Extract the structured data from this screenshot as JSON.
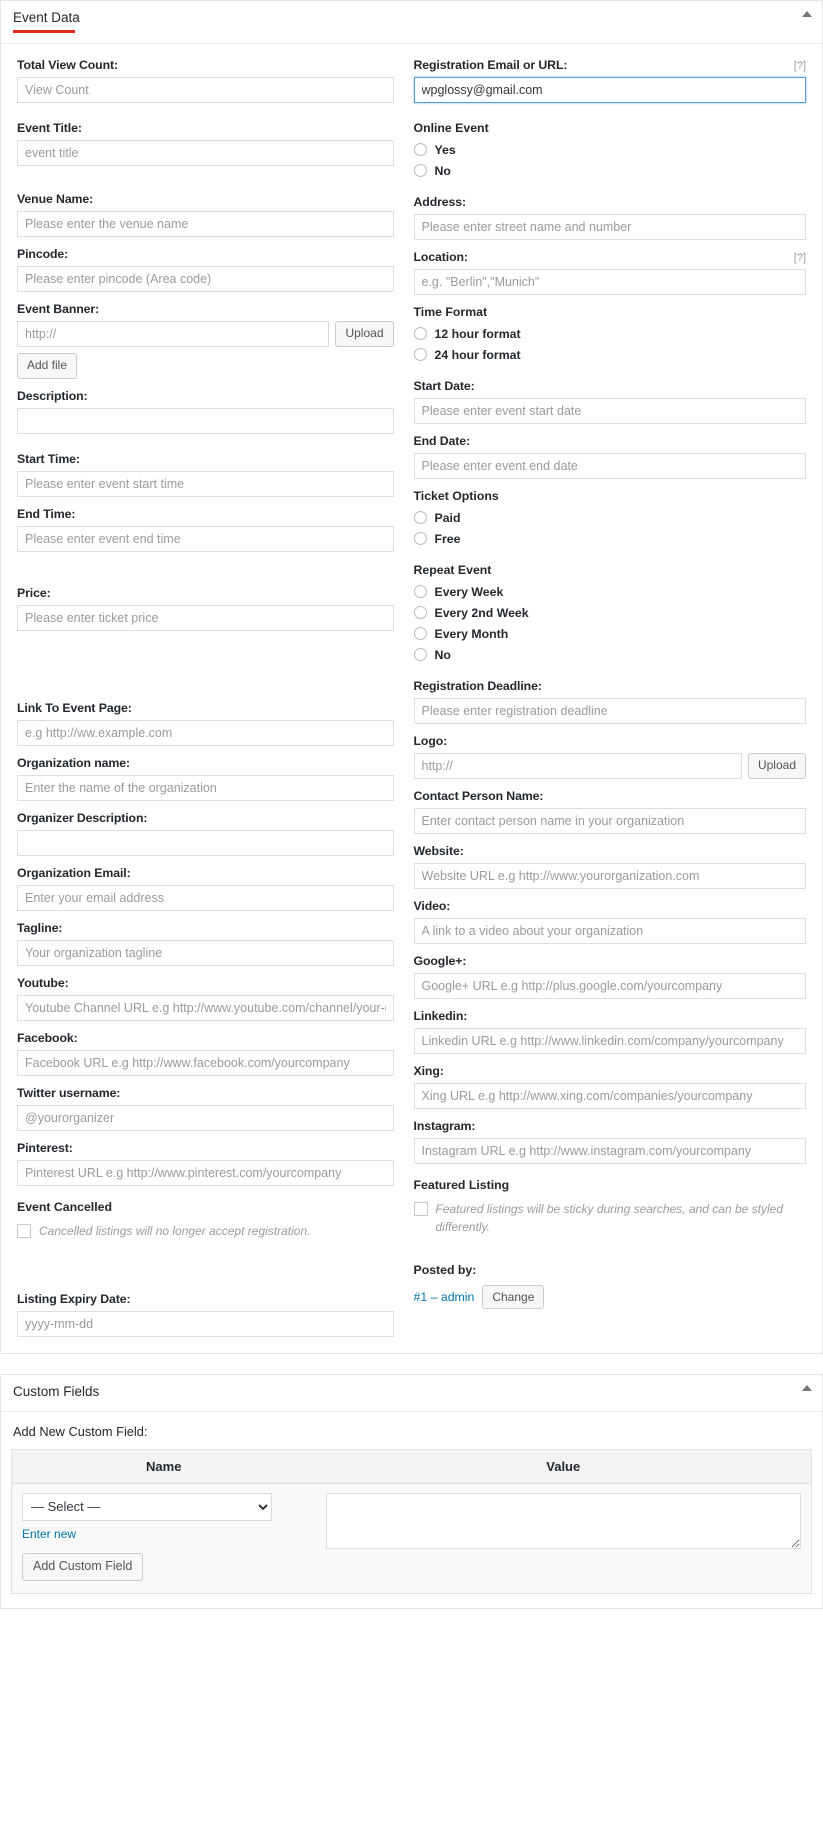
{
  "event_data_box": {
    "title": "Event Data",
    "collapse_icon": "chevron-up-icon",
    "help_tip": "[?]",
    "left": {
      "total_view_count": {
        "label": "Total View Count:",
        "placeholder": "View Count",
        "value": ""
      },
      "event_title": {
        "label": "Event Title:",
        "placeholder": "event title",
        "value": ""
      },
      "venue_name": {
        "label": "Venue Name:",
        "placeholder": "Please enter the venue name",
        "value": ""
      },
      "pincode": {
        "label": "Pincode:",
        "placeholder": "Please enter pincode (Area code)",
        "value": ""
      },
      "event_banner": {
        "label": "Event Banner:",
        "placeholder": "http://",
        "value": "",
        "upload_label": "Upload",
        "add_file_label": "Add file"
      },
      "description": {
        "label": "Description:",
        "value": ""
      },
      "start_time": {
        "label": "Start Time:",
        "placeholder": "Please enter event start time",
        "value": ""
      },
      "end_time": {
        "label": "End Time:",
        "placeholder": "Please enter event end time",
        "value": ""
      },
      "price": {
        "label": "Price:",
        "placeholder": "Please enter ticket price",
        "value": ""
      },
      "link_to_event_page": {
        "label": "Link To Event Page:",
        "placeholder": "e.g http://ww.example.com",
        "value": ""
      },
      "organization_name": {
        "label": "Organization name:",
        "placeholder": "Enter the name of the organization",
        "value": ""
      },
      "organizer_description": {
        "label": "Organizer Description:",
        "value": ""
      },
      "organization_email": {
        "label": "Organization Email:",
        "placeholder": "Enter your email address",
        "value": ""
      },
      "tagline": {
        "label": "Tagline:",
        "placeholder": "Your organization tagline",
        "value": ""
      },
      "youtube": {
        "label": "Youtube:",
        "placeholder": "Youtube Channel URL e.g http://www.youtube.com/channel/your-channel",
        "value": ""
      },
      "facebook": {
        "label": "Facebook:",
        "placeholder": "Facebook URL e.g http://www.facebook.com/yourcompany",
        "value": ""
      },
      "twitter": {
        "label": "Twitter username:",
        "placeholder": "@yourorganizer",
        "value": ""
      },
      "pinterest": {
        "label": "Pinterest:",
        "placeholder": "Pinterest URL e.g http://www.pinterest.com/yourcompany",
        "value": ""
      },
      "event_cancelled": {
        "label": "Event Cancelled",
        "checkbox_text": "Cancelled listings will no longer accept registration.",
        "checked": false
      },
      "listing_expiry_date": {
        "label": "Listing Expiry Date:",
        "placeholder": "yyyy-mm-dd",
        "value": ""
      }
    },
    "right": {
      "registration_email_or_url": {
        "label": "Registration Email or URL:",
        "help": "[?]",
        "value": "wpglossy@gmail.com",
        "placeholder": ""
      },
      "online_event": {
        "label": "Online Event",
        "options": [
          "Yes",
          "No"
        ],
        "selected": ""
      },
      "address": {
        "label": "Address:",
        "placeholder": "Please enter street name and number",
        "value": ""
      },
      "location": {
        "label": "Location:",
        "help": "[?]",
        "placeholder": "e.g. \"Berlin\",\"Munich\"",
        "value": ""
      },
      "time_format": {
        "label": "Time Format",
        "options": [
          "12 hour format",
          "24 hour format"
        ],
        "selected": ""
      },
      "start_date": {
        "label": "Start Date:",
        "placeholder": "Please enter event start date",
        "value": ""
      },
      "end_date": {
        "label": "End Date:",
        "placeholder": "Please enter event end date",
        "value": ""
      },
      "ticket_options": {
        "label": "Ticket Options",
        "options": [
          "Paid",
          "Free"
        ],
        "selected": ""
      },
      "repeat_event": {
        "label": "Repeat Event",
        "options": [
          "Every Week",
          "Every 2nd Week",
          "Every Month",
          "No"
        ],
        "selected": ""
      },
      "registration_deadline": {
        "label": "Registration Deadline:",
        "placeholder": "Please enter registration deadline",
        "value": ""
      },
      "logo": {
        "label": "Logo:",
        "placeholder": "http://",
        "value": "",
        "upload_label": "Upload"
      },
      "contact_person_name": {
        "label": "Contact Person Name:",
        "placeholder": "Enter contact person name in your organization",
        "value": ""
      },
      "website": {
        "label": "Website:",
        "placeholder": "Website URL e.g http://www.yourorganization.com",
        "value": ""
      },
      "video": {
        "label": "Video:",
        "placeholder": "A link to a video about your organization",
        "value": ""
      },
      "google_plus": {
        "label": "Google+:",
        "placeholder": "Google+ URL e.g http://plus.google.com/yourcompany",
        "value": ""
      },
      "linkedin": {
        "label": "Linkedin:",
        "placeholder": "Linkedin URL e.g http://www.linkedin.com/company/yourcompany",
        "value": ""
      },
      "xing": {
        "label": "Xing:",
        "placeholder": "Xing URL e.g http://www.xing.com/companies/yourcompany",
        "value": ""
      },
      "instagram": {
        "label": "Instagram:",
        "placeholder": "Instagram URL e.g http://www.instagram.com/yourcompany",
        "value": ""
      },
      "featured_listing": {
        "label": "Featured Listing",
        "checkbox_text": "Featured listings will be sticky during searches, and can be styled differently.",
        "checked": false
      },
      "posted_by": {
        "label": "Posted by:",
        "user": "#1 – admin",
        "change_label": "Change"
      }
    }
  },
  "custom_fields_box": {
    "title": "Custom Fields",
    "collapse_icon": "chevron-up-icon",
    "subtitle": "Add New Custom Field:",
    "columns": {
      "name": "Name",
      "value": "Value"
    },
    "select_value": "— Select —",
    "select_options": [
      "— Select —"
    ],
    "enter_new_label": "Enter new",
    "value_textarea": "",
    "add_button_label": "Add Custom Field"
  },
  "colors": {
    "accent_red": "#e02b20",
    "link_blue": "#0073aa",
    "focus_blue": "#5b9dd9",
    "border_grey": "#dddddd"
  }
}
